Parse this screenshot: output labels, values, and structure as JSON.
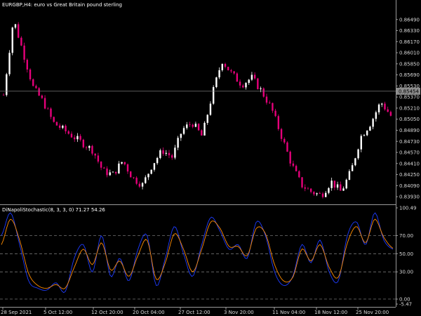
{
  "main_pane": {
    "title": "EURGBP,H4:  euro vs Great Britain pound sterling",
    "price_labels": [
      "0.86490",
      "0.86330",
      "0.86170",
      "0.86010",
      "0.85850",
      "0.85690",
      "0.85530",
      "0.85370",
      "0.85210",
      "0.85050",
      "0.84890",
      "0.84730",
      "0.84570",
      "0.84410",
      "0.84250",
      "0.84090",
      "0.83930"
    ],
    "current_price": "0.85454",
    "bull_color": "#ffffff",
    "bear_color": "#e6007a"
  },
  "indicator_pane": {
    "title": "DiNapoliStochastic(8, 3, 3, 0) 71.27 54.26",
    "scale_labels": [
      "100.49",
      "70.00",
      "50.00",
      "30.00",
      "0.00",
      "-5.47"
    ],
    "level_values": [
      70,
      50,
      30,
      0
    ],
    "fast_line_color": "#1e3cff",
    "slow_line_color": "#ff8c00"
  },
  "time_axis": {
    "labels": [
      "28 Sep 2021",
      "5 Oct 12:00",
      "12 Oct 20:00",
      "20 Oct 04:00",
      "27 Oct 12:00",
      "3 Nov 20:00",
      "11 Nov 04:00",
      "18 Nov 12:00",
      "25 Nov 20:00"
    ]
  },
  "chart_data": [
    {
      "type": "candlestick",
      "title": "EURGBP,H4:  euro vs Great Britain pound sterling",
      "x": [
        "28 Sep 2021",
        "5 Oct 12:00",
        "12 Oct 20:00",
        "20 Oct 04:00",
        "27 Oct 12:00",
        "3 Nov 20:00",
        "11 Nov 04:00",
        "18 Nov 12:00",
        "25 Nov 20:00"
      ],
      "close_path": [
        0.854,
        0.865,
        0.86,
        0.855,
        0.853,
        0.85,
        0.849,
        0.848,
        0.847,
        0.846,
        0.843,
        0.8425,
        0.8445,
        0.842,
        0.841,
        0.844,
        0.846,
        0.845,
        0.849,
        0.85,
        0.848,
        0.854,
        0.859,
        0.857,
        0.8555,
        0.8565,
        0.8545,
        0.852,
        0.848,
        0.844,
        0.841,
        0.84,
        0.8395,
        0.8415,
        0.84,
        0.843,
        0.848,
        0.85,
        0.853,
        0.851
      ],
      "ylim": [
        0.8385,
        0.8665
      ],
      "current_price": 0.85454
    },
    {
      "type": "line",
      "title": "DiNapoliStochastic(8, 3, 3, 0) 71.27 54.26",
      "ylim": [
        -5.47,
        100.49
      ],
      "levels": [
        70,
        50,
        30,
        0
      ],
      "series": [
        {
          "values": [
            70,
            95,
            60,
            20,
            12,
            10,
            18,
            8,
            45,
            60,
            30,
            70,
            25,
            45,
            20,
            55,
            70,
            15,
            45,
            80,
            50,
            25,
            60,
            90,
            75,
            55,
            60,
            45,
            85,
            70,
            30,
            15,
            25,
            60,
            40,
            65,
            30,
            20,
            70,
            85,
            60,
            95,
            65,
            55
          ]
        },
        {
          "values": [
            60,
            88,
            65,
            28,
            15,
            12,
            16,
            12,
            35,
            55,
            38,
            62,
            32,
            42,
            25,
            48,
            65,
            22,
            40,
            72,
            55,
            30,
            55,
            85,
            78,
            58,
            58,
            48,
            78,
            72,
            38,
            20,
            24,
            55,
            42,
            60,
            35,
            24,
            62,
            80,
            62,
            88,
            68,
            56
          ]
        }
      ]
    }
  ]
}
